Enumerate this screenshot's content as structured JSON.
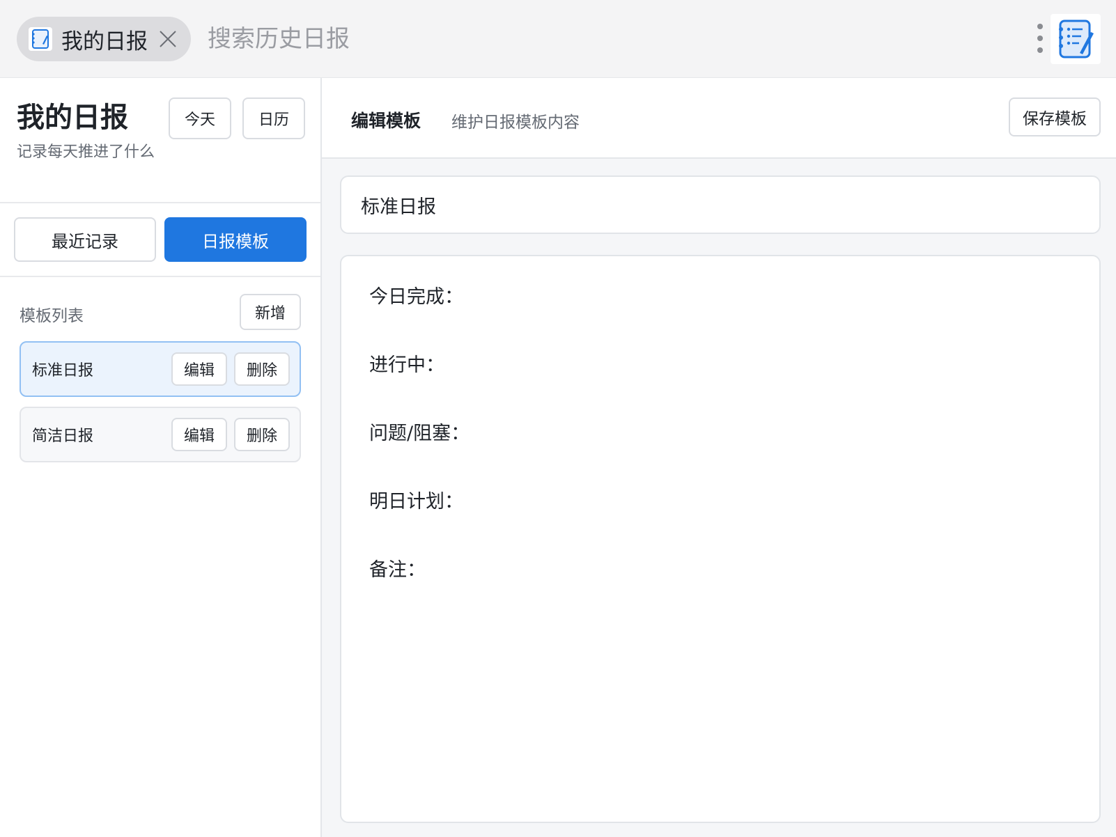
{
  "app_tab": {
    "label": "我的日报"
  },
  "search": {
    "placeholder": "搜索历史日报"
  },
  "sidebar": {
    "title": "我的日报",
    "subtitle": "记录每天推进了什么",
    "today_label": "今天",
    "calendar_label": "日历",
    "tabs": [
      {
        "label": "最近记录",
        "active": false
      },
      {
        "label": "日报模板",
        "active": true
      }
    ],
    "list_label": "模板列表",
    "add_label": "新增",
    "templates": [
      {
        "name": "标准日报",
        "edit_label": "编辑",
        "delete_label": "删除",
        "selected": true
      },
      {
        "name": "简洁日报",
        "edit_label": "编辑",
        "delete_label": "删除",
        "selected": false
      }
    ]
  },
  "editor": {
    "title": "编辑模板",
    "subtitle": "维护日报模板内容",
    "save_label": "保存模板",
    "template_name": "标准日报",
    "content_lines": [
      "今日完成：",
      "进行中：",
      "问题/阻塞：",
      "明日计划：",
      "备注："
    ]
  },
  "colors": {
    "accent": "#1f77e0",
    "selected_bg": "#ebf3fd",
    "selected_border": "#92c0f3",
    "main_bg": "#f5f6f8",
    "topbar_bg": "#f4f4f5"
  },
  "icons": {
    "tab_icon": "notebook-icon",
    "close": "close-icon",
    "more": "more-vertical-icon",
    "logo": "notebook-pen-icon"
  }
}
